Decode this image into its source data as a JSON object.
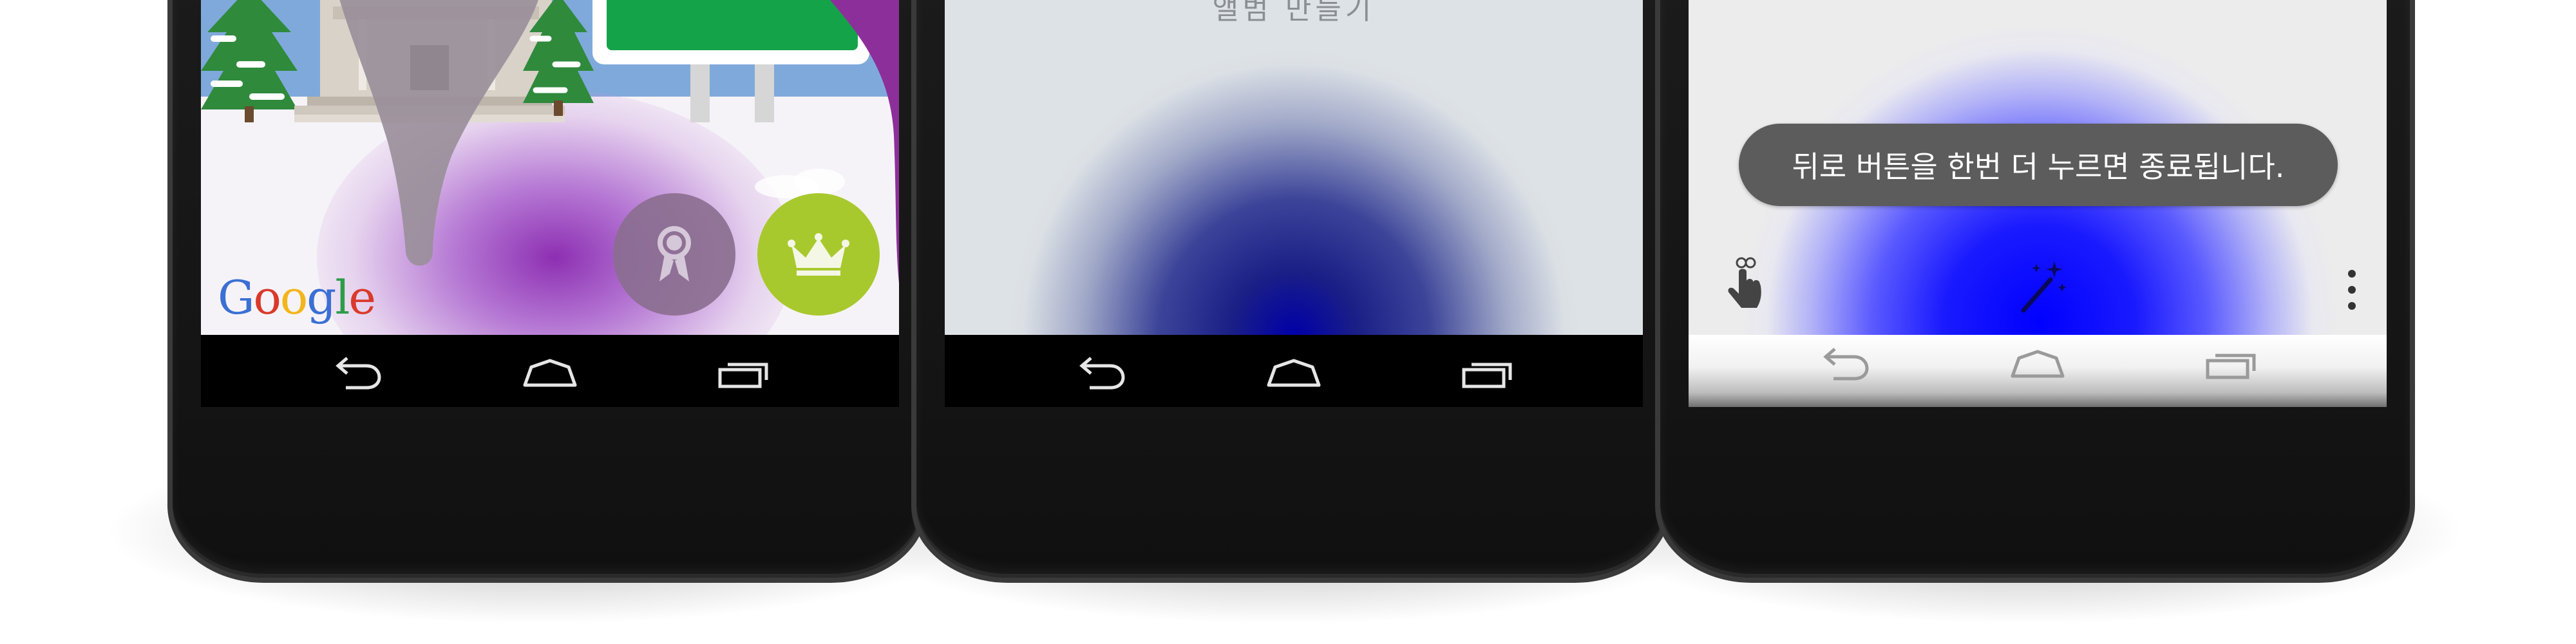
{
  "phones": [
    {
      "id": "phone-1",
      "brand_logo": [
        "G",
        "o",
        "o",
        "g",
        "l",
        "e"
      ],
      "brand_colors": [
        "#3b6fd4",
        "#d93a2b",
        "#f2b51b",
        "#3b6fd4",
        "#2e9c49",
        "#d93a2b"
      ],
      "buttons": [
        {
          "icon": "award-ribbon-icon",
          "color": "#8a6e8f"
        },
        {
          "icon": "crown-icon",
          "color": "#a8c92d"
        }
      ]
    },
    {
      "id": "phone-2",
      "top_text": "앨범 만들기"
    },
    {
      "id": "phone-3",
      "toast_text": "뒤로 버튼을 한번 더 누르면 종료됩니다.",
      "icons": [
        "finger-ribbon-icon",
        "magic-wand-icon",
        "overflow-menu-icon"
      ]
    }
  ],
  "navbar": {
    "icons": [
      "back-icon",
      "home-icon",
      "recents-icon"
    ]
  }
}
